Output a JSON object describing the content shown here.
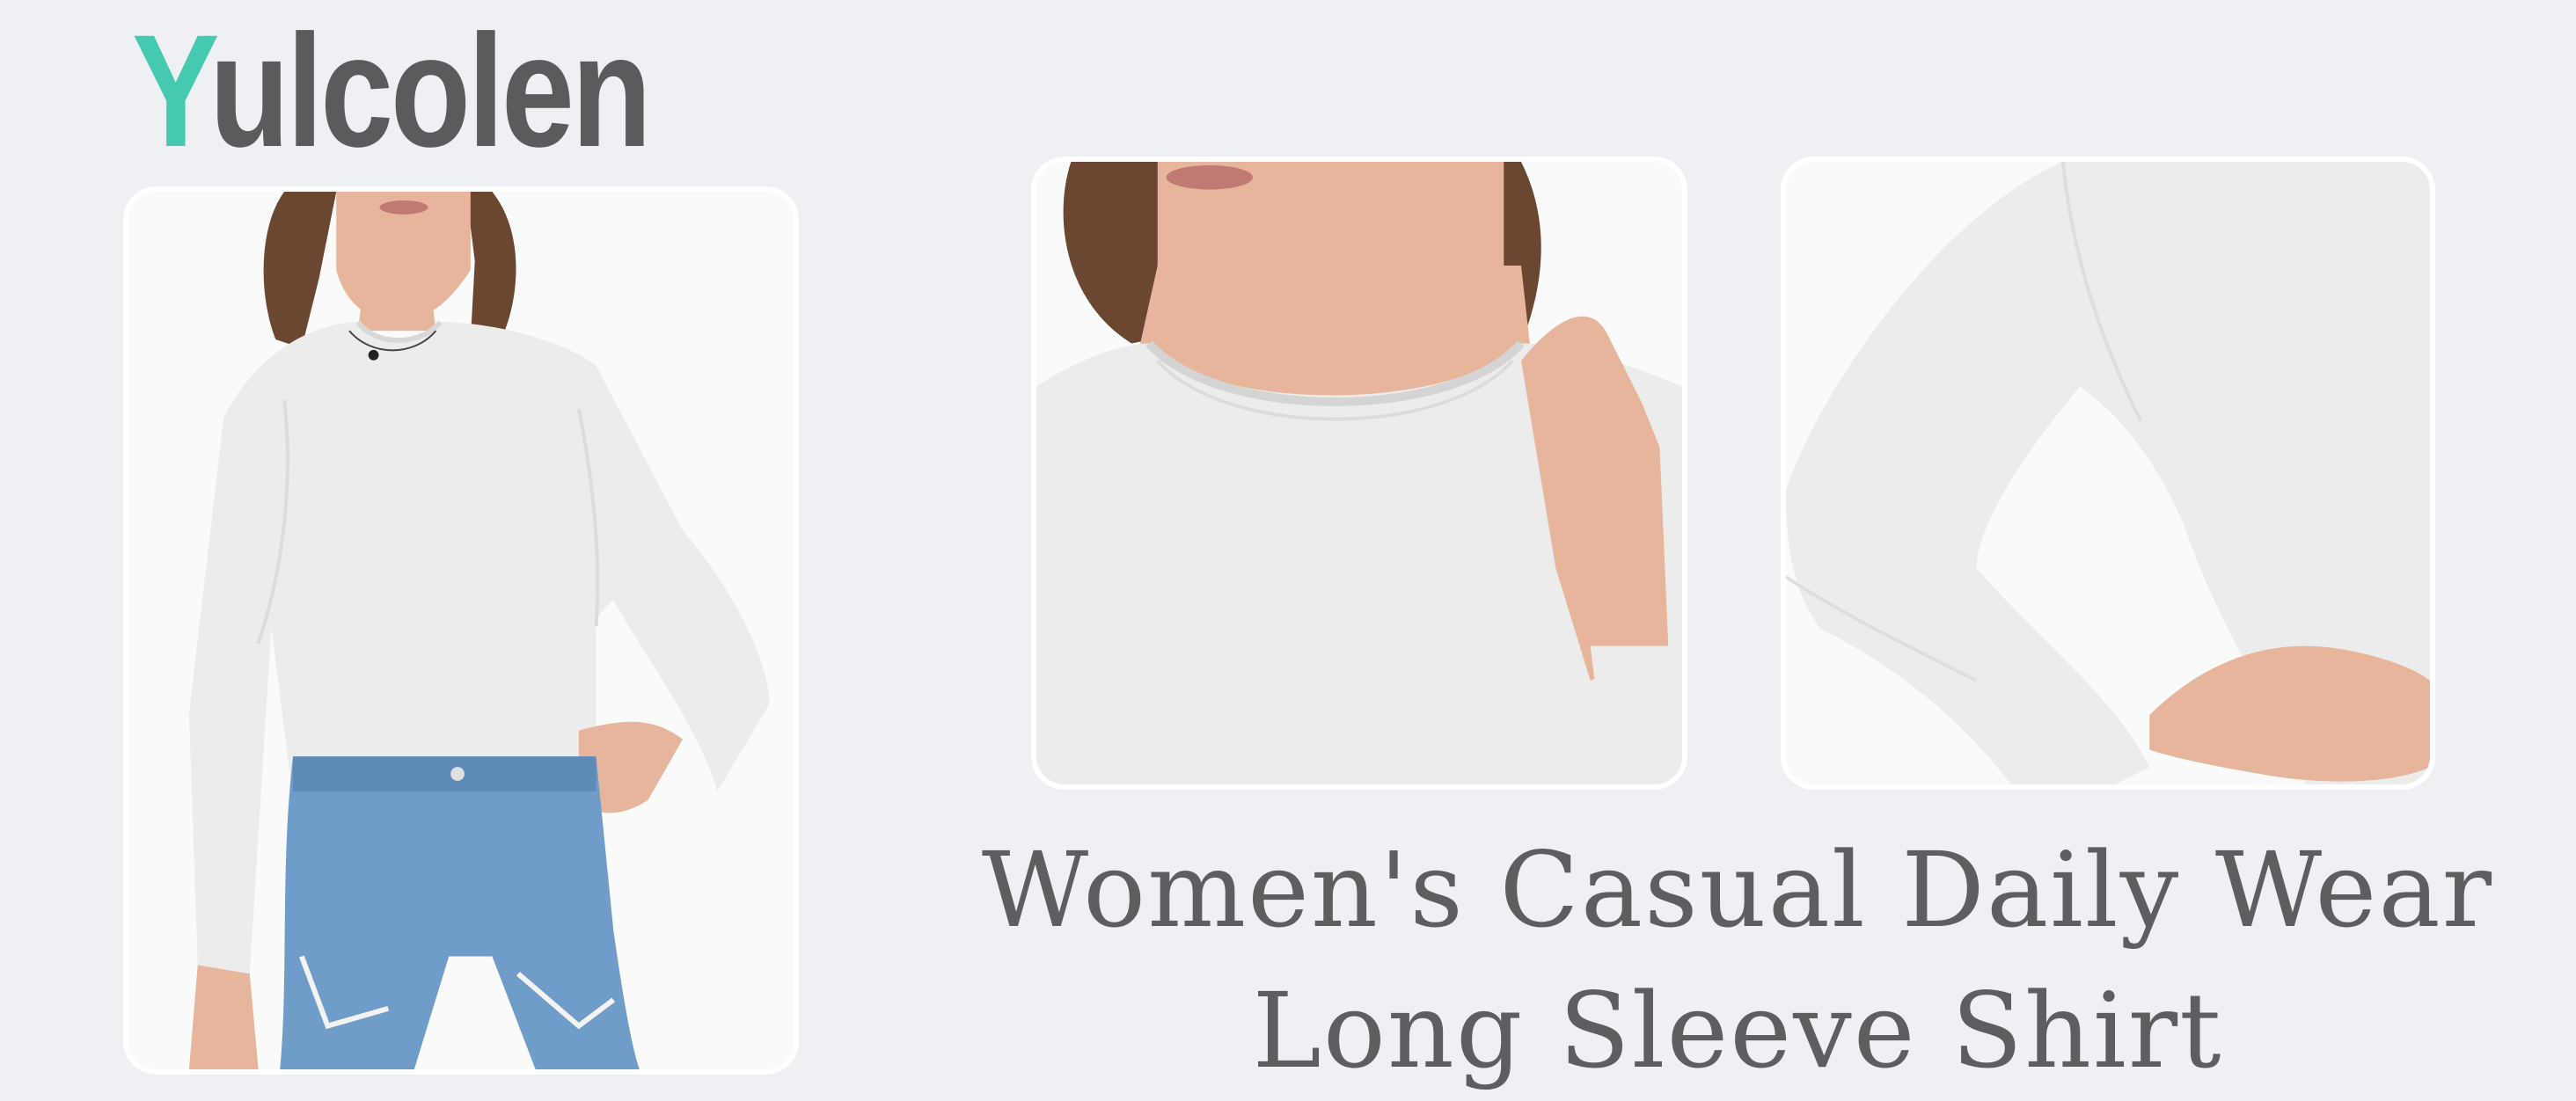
{
  "brand": {
    "initial": "Y",
    "rest": "ulcolen",
    "colors": {
      "initial": "#46c9b1",
      "rest": "#5b5b5d"
    }
  },
  "headline": {
    "line1": "Women's Casual Daily Wear",
    "line2": "Long Sleeve Shirt"
  },
  "photos": [
    {
      "name": "model-full-view",
      "subject": "woman in white long sleeve shirt and denim shorts"
    },
    {
      "name": "neckline-closeup",
      "subject": "crew neckline detail"
    },
    {
      "name": "sleeve-closeup",
      "subject": "long sleeve detail"
    }
  ],
  "colors": {
    "background": "#eff0f4",
    "shirt": "#ededed",
    "denim": "#6f9cc9",
    "text": "#5e5e60"
  }
}
